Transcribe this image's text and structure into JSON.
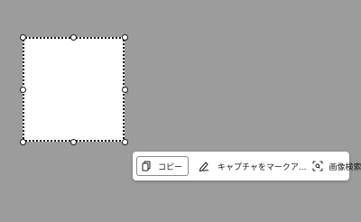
{
  "toolbar": {
    "copy": {
      "label": "コピー",
      "icon": "copy-icon"
    },
    "markup": {
      "label": "キャプチャをマークア...",
      "icon": "pen-icon"
    },
    "image_search": {
      "label": "画像検索",
      "icon": "visual-search-icon"
    }
  },
  "colors": {
    "background": "#9c9c9c",
    "selection_fill": "#ffffff",
    "selection_border": "#1a1a1a",
    "toolbar_bg": "#ffffff"
  }
}
